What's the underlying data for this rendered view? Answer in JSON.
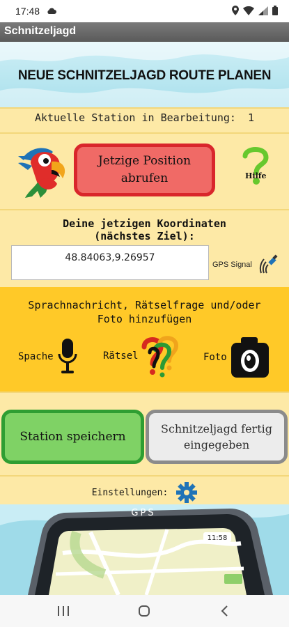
{
  "status_bar": {
    "time": "17:48",
    "icons": [
      "cloud-icon",
      "location-icon",
      "wifi-icon",
      "signal-icon",
      "battery-icon"
    ]
  },
  "app_title": "Schnitzeljagd",
  "banner": {
    "title": "NEUE SCHNITZELJAGD ROUTE PLANEN"
  },
  "station": {
    "label": "Aktuelle Station in Bearbeitung:",
    "value": "1"
  },
  "position_button": {
    "label_line1": "Jetzige Position",
    "label_line2": "abrufen"
  },
  "help": {
    "label": "Hilfe"
  },
  "coordinates": {
    "label_line1": "Deine jetzigen Koordinaten",
    "label_line2": "(nächstes Ziel):",
    "value": "48.84063,9.26957"
  },
  "gps_signal": {
    "label": "GPS Signal"
  },
  "media": {
    "title_line1": "Sprachnachricht, Rätselfrage und/oder",
    "title_line2": "Foto hinzufügen",
    "items": [
      {
        "label": "Spache",
        "icon": "microphone-icon"
      },
      {
        "label": "Rätsel",
        "icon": "question-marks-icon"
      },
      {
        "label": "Foto",
        "icon": "camera-icon"
      }
    ]
  },
  "save_button": {
    "label": "Station speichern"
  },
  "finish_button": {
    "label_line1": "Schnitzeljagd fertig",
    "label_line2": "eingegeben"
  },
  "settings": {
    "label": "Einstellungen:",
    "icon": "gear-icon"
  },
  "gps_device": {
    "label": "GPS",
    "time": "11:58"
  },
  "colors": {
    "background": "#fde9a6",
    "media_section": "#ffc928",
    "position_button": "#f06a66",
    "save_button": "#7fd265",
    "finish_button": "#ececec",
    "accent_blue": "#1f73b7"
  },
  "nav_bar": {
    "icons": [
      "recents-icon",
      "home-icon",
      "back-icon"
    ]
  }
}
